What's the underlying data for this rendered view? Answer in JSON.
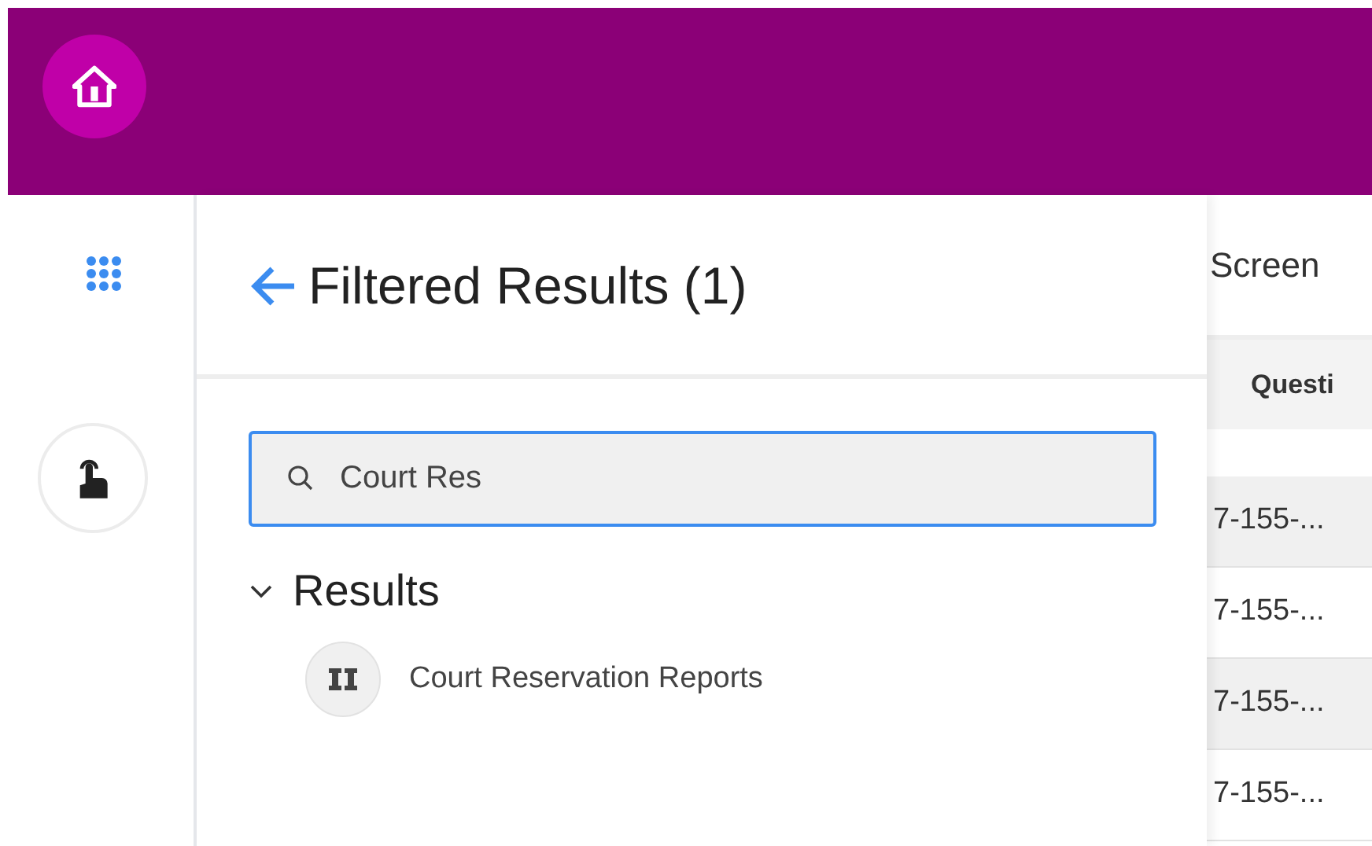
{
  "panel": {
    "title": "Filtered Results (1)",
    "search": {
      "value": "Court Res"
    },
    "section": {
      "label": "Results",
      "expanded": true,
      "items": [
        {
          "label": "Court Reservation Reports"
        }
      ]
    }
  },
  "background_table": {
    "title": "Screen",
    "columns": [
      "Questi"
    ],
    "rows": [
      {
        "cells": [
          "7-155-..."
        ]
      },
      {
        "cells": [
          "7-155-..."
        ]
      },
      {
        "cells": [
          "7-155-..."
        ]
      },
      {
        "cells": [
          "7-155-..."
        ]
      }
    ]
  }
}
